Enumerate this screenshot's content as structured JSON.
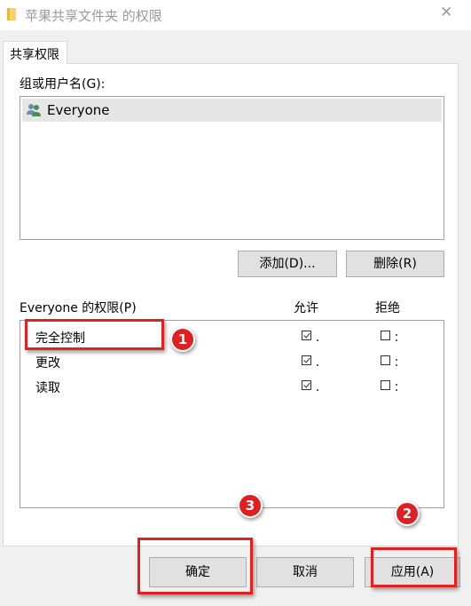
{
  "window": {
    "title": "苹果共享文件夹 的权限",
    "close_glyph": "✕"
  },
  "tab": {
    "label": "共享权限"
  },
  "groups": {
    "label": "组或用户名(G):",
    "items": [
      {
        "name": "Everyone",
        "icon": "users-icon"
      }
    ]
  },
  "buttons": {
    "add": "添加(D)...",
    "remove": "删除(R)",
    "ok": "确定",
    "cancel": "取消",
    "apply": "应用(A)"
  },
  "permissions": {
    "label": "Everyone 的权限(P)",
    "allow_header": "允许",
    "deny_header": "拒绝",
    "rows": [
      {
        "name": "完全控制",
        "allow": true,
        "deny": false
      },
      {
        "name": "更改",
        "allow": true,
        "deny": false
      },
      {
        "name": "读取",
        "allow": true,
        "deny": false
      }
    ]
  },
  "annotations": {
    "badge_1": "1",
    "badge_2": "2",
    "badge_3": "3",
    "color": "#e02020"
  }
}
